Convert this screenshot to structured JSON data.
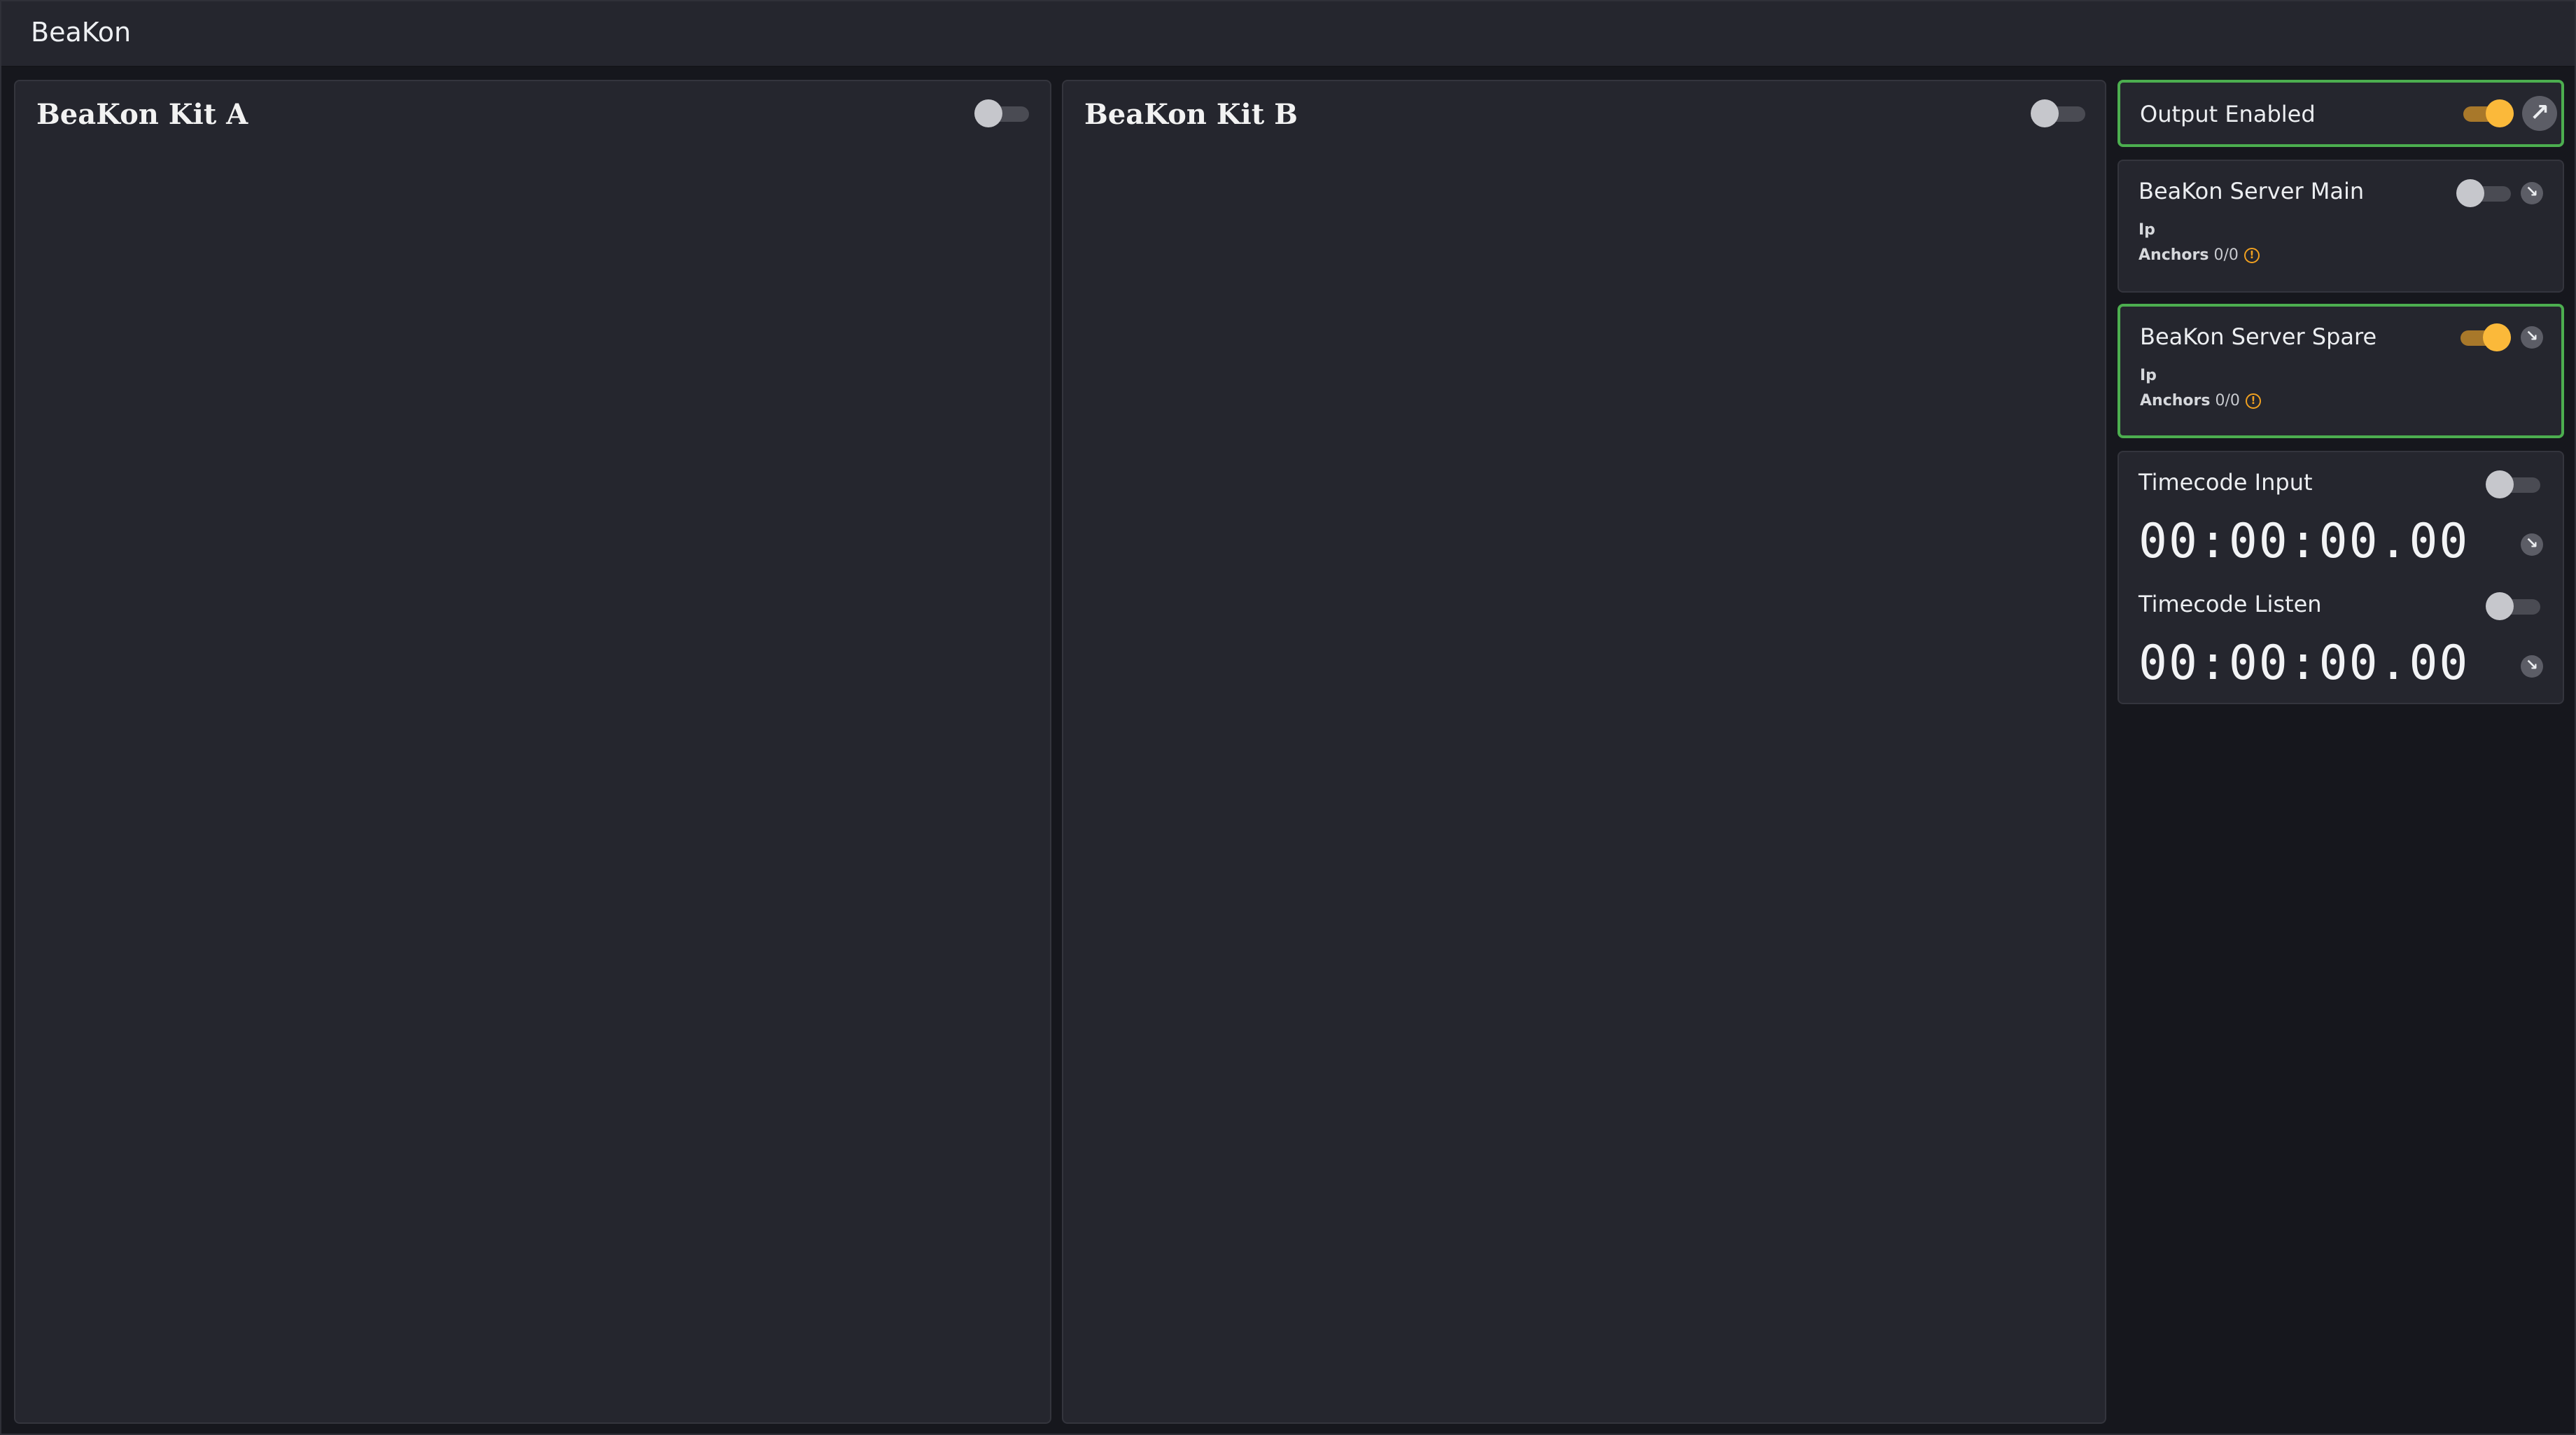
{
  "app": {
    "title": "BeaKon"
  },
  "kits": [
    {
      "title": "BeaKon Kit A",
      "enabled": false
    },
    {
      "title": "BeaKon Kit B",
      "enabled": false
    }
  ],
  "output": {
    "label": "Output Enabled",
    "enabled": true,
    "icon": "arrow-up-right-icon"
  },
  "servers": [
    {
      "title": "BeaKon Server Main",
      "enabled": false,
      "ip_label": "Ip",
      "anchors_label": "Anchors",
      "anchors_value": "0/0",
      "icon": "arrow-down-right-icon",
      "warning_icon": "warning-icon"
    },
    {
      "title": "BeaKon Server Spare",
      "enabled": true,
      "ip_label": "Ip",
      "anchors_label": "Anchors",
      "anchors_value": "0/0",
      "icon": "arrow-down-right-icon",
      "warning_icon": "warning-icon"
    }
  ],
  "timecode": {
    "input": {
      "label": "Timecode Input",
      "enabled": false,
      "value": "00:00:00.00"
    },
    "listen": {
      "label": "Timecode Listen",
      "enabled": false,
      "value": "00:00:00.00"
    }
  },
  "colors": {
    "accent": "#fbb93a",
    "active_border": "#4cae4f",
    "warning": "#f0a020",
    "panel": "#25262e",
    "background": "#16171d"
  }
}
